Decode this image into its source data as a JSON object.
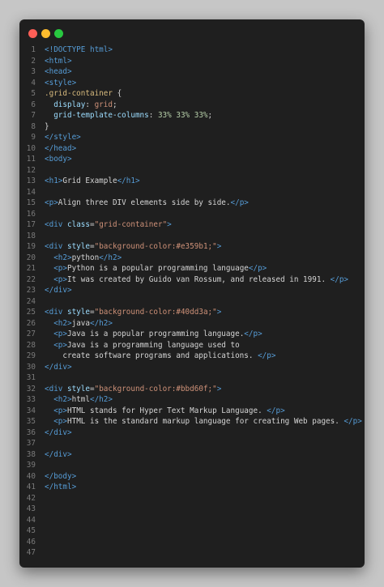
{
  "window": {
    "controls": [
      "close",
      "minimize",
      "maximize"
    ]
  },
  "lines": [
    {
      "n": "1",
      "segs": [
        {
          "t": "<!DOCTYPE html>",
          "c": "tag"
        }
      ]
    },
    {
      "n": "2",
      "segs": [
        {
          "t": "<html>",
          "c": "tag"
        }
      ]
    },
    {
      "n": "3",
      "segs": [
        {
          "t": "<head>",
          "c": "tag"
        }
      ]
    },
    {
      "n": "4",
      "segs": [
        {
          "t": "<style>",
          "c": "tag"
        }
      ]
    },
    {
      "n": "5",
      "segs": [
        {
          "t": ".grid-container",
          "c": "sel"
        },
        {
          "t": " {",
          "c": "txt"
        }
      ]
    },
    {
      "n": "6",
      "segs": [
        {
          "t": "  display",
          "c": "prop"
        },
        {
          "t": ": ",
          "c": "txt"
        },
        {
          "t": "grid",
          "c": "val"
        },
        {
          "t": ";",
          "c": "txt"
        }
      ]
    },
    {
      "n": "7",
      "segs": [
        {
          "t": "  grid-template-columns",
          "c": "prop"
        },
        {
          "t": ": ",
          "c": "txt"
        },
        {
          "t": "33% 33% 33%",
          "c": "num"
        },
        {
          "t": ";",
          "c": "txt"
        }
      ]
    },
    {
      "n": "8",
      "segs": [
        {
          "t": "}",
          "c": "txt"
        }
      ]
    },
    {
      "n": "9",
      "segs": [
        {
          "t": "</style>",
          "c": "tag"
        }
      ]
    },
    {
      "n": "10",
      "segs": [
        {
          "t": "</head>",
          "c": "tag"
        }
      ]
    },
    {
      "n": "11",
      "segs": [
        {
          "t": "<body>",
          "c": "tag"
        }
      ]
    },
    {
      "n": "12",
      "segs": []
    },
    {
      "n": "13",
      "segs": [
        {
          "t": "<h1>",
          "c": "tag"
        },
        {
          "t": "Grid Example",
          "c": "txt"
        },
        {
          "t": "</h1>",
          "c": "tag"
        }
      ]
    },
    {
      "n": "14",
      "segs": []
    },
    {
      "n": "15",
      "segs": [
        {
          "t": "<p>",
          "c": "tag"
        },
        {
          "t": "Align three DIV elements side by side.",
          "c": "txt"
        },
        {
          "t": "</p>",
          "c": "tag"
        }
      ]
    },
    {
      "n": "16",
      "segs": []
    },
    {
      "n": "17",
      "segs": [
        {
          "t": "<div ",
          "c": "tag"
        },
        {
          "t": "class",
          "c": "attr"
        },
        {
          "t": "=",
          "c": "txt"
        },
        {
          "t": "\"grid-container\"",
          "c": "str"
        },
        {
          "t": ">",
          "c": "tag"
        }
      ]
    },
    {
      "n": "18",
      "segs": []
    },
    {
      "n": "19",
      "segs": [
        {
          "t": "<div ",
          "c": "tag"
        },
        {
          "t": "style",
          "c": "attr"
        },
        {
          "t": "=",
          "c": "txt"
        },
        {
          "t": "\"background-color:#e359b1;\"",
          "c": "str"
        },
        {
          "t": ">",
          "c": "tag"
        }
      ]
    },
    {
      "n": "20",
      "segs": [
        {
          "t": "  <h2>",
          "c": "tag"
        },
        {
          "t": "python",
          "c": "txt"
        },
        {
          "t": "</h2>",
          "c": "tag"
        }
      ]
    },
    {
      "n": "21",
      "segs": [
        {
          "t": "  <p>",
          "c": "tag"
        },
        {
          "t": "Python is a popular programming language",
          "c": "txt"
        },
        {
          "t": "</p>",
          "c": "tag"
        }
      ]
    },
    {
      "n": "22",
      "segs": [
        {
          "t": "  <p>",
          "c": "tag"
        },
        {
          "t": "It was created by Guido van Rossum, and released in 1991. ",
          "c": "txt"
        },
        {
          "t": "</p>",
          "c": "tag"
        }
      ]
    },
    {
      "n": "23",
      "segs": [
        {
          "t": "</div>",
          "c": "tag"
        }
      ]
    },
    {
      "n": "24",
      "segs": []
    },
    {
      "n": "25",
      "segs": [
        {
          "t": "<div ",
          "c": "tag"
        },
        {
          "t": "style",
          "c": "attr"
        },
        {
          "t": "=",
          "c": "txt"
        },
        {
          "t": "\"background-color:#40dd3a;\"",
          "c": "str"
        },
        {
          "t": ">",
          "c": "tag"
        }
      ]
    },
    {
      "n": "26",
      "segs": [
        {
          "t": "  <h2>",
          "c": "tag"
        },
        {
          "t": "java",
          "c": "txt"
        },
        {
          "t": "</h2>",
          "c": "tag"
        }
      ]
    },
    {
      "n": "27",
      "segs": [
        {
          "t": "  <p>",
          "c": "tag"
        },
        {
          "t": "Java is a popular programming language.",
          "c": "txt"
        },
        {
          "t": "</p>",
          "c": "tag"
        }
      ]
    },
    {
      "n": "28",
      "segs": [
        {
          "t": "  <p>",
          "c": "tag"
        },
        {
          "t": "Java is a programming language used to",
          "c": "txt"
        }
      ]
    },
    {
      "n": "29",
      "segs": [
        {
          "t": "    create software programs and applications. ",
          "c": "txt"
        },
        {
          "t": "</p>",
          "c": "tag"
        }
      ]
    },
    {
      "n": "30",
      "segs": [
        {
          "t": "</div>",
          "c": "tag"
        }
      ]
    },
    {
      "n": "31",
      "segs": []
    },
    {
      "n": "32",
      "segs": [
        {
          "t": "<div ",
          "c": "tag"
        },
        {
          "t": "style",
          "c": "attr"
        },
        {
          "t": "=",
          "c": "txt"
        },
        {
          "t": "\"background-color:#bbd60f;\"",
          "c": "str"
        },
        {
          "t": ">",
          "c": "tag"
        }
      ]
    },
    {
      "n": "33",
      "segs": [
        {
          "t": "  <h2>",
          "c": "tag"
        },
        {
          "t": "html",
          "c": "txt"
        },
        {
          "t": "</h2>",
          "c": "tag"
        }
      ]
    },
    {
      "n": "34",
      "segs": [
        {
          "t": "  <p>",
          "c": "tag"
        },
        {
          "t": "HTML stands for Hyper Text Markup Language. ",
          "c": "txt"
        },
        {
          "t": "</p>",
          "c": "tag"
        }
      ]
    },
    {
      "n": "35",
      "segs": [
        {
          "t": "  <p>",
          "c": "tag"
        },
        {
          "t": "HTML is the standard markup language for creating Web pages. ",
          "c": "txt"
        },
        {
          "t": "</p>",
          "c": "tag"
        }
      ]
    },
    {
      "n": "36",
      "segs": [
        {
          "t": "</div>",
          "c": "tag"
        }
      ]
    },
    {
      "n": "37",
      "segs": []
    },
    {
      "n": "38",
      "segs": [
        {
          "t": "</div>",
          "c": "tag"
        }
      ]
    },
    {
      "n": "39",
      "segs": []
    },
    {
      "n": "40",
      "segs": [
        {
          "t": "</body>",
          "c": "tag"
        }
      ]
    },
    {
      "n": "41",
      "segs": [
        {
          "t": "</html>",
          "c": "tag"
        }
      ]
    },
    {
      "n": "42",
      "segs": []
    },
    {
      "n": "43",
      "segs": []
    },
    {
      "n": "44",
      "segs": []
    },
    {
      "n": "45",
      "segs": []
    },
    {
      "n": "46",
      "segs": []
    },
    {
      "n": "47",
      "segs": []
    }
  ]
}
